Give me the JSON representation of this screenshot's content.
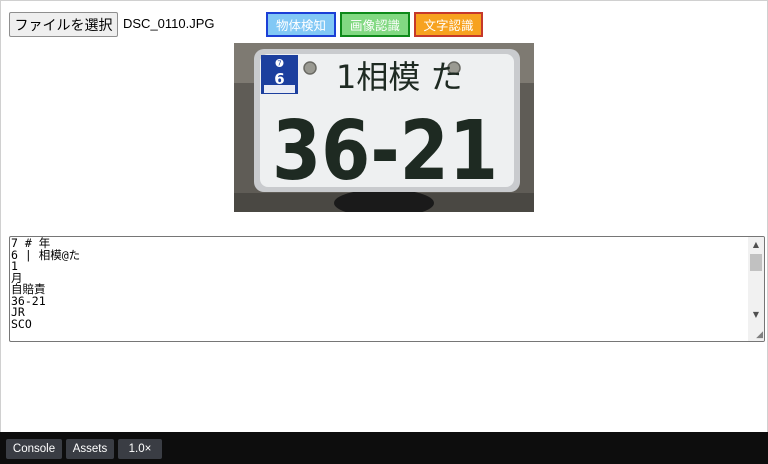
{
  "file_input": {
    "button_label": "ファイルを選択",
    "file_name": "DSC_0110.JPG"
  },
  "actions": {
    "object_detection": "物体検知",
    "image_recognition": "画像認識",
    "text_recognition": "文字認識"
  },
  "preview": {
    "plate_region_line": "1相模 た",
    "plate_number": "36-21",
    "sticker_month": "6",
    "sticker_year": "7"
  },
  "result": {
    "text": "7 # 年\n6 | 相模@た\n1\n月\n自賠責\n36-21\nJR\nSCO"
  },
  "devbar": {
    "console_label": "Console",
    "assets_label": "Assets",
    "zoom_label": "1.0×"
  },
  "colors": {
    "object_btn_bg": "#82c8f5",
    "image_btn_bg": "#82d982",
    "text_btn_bg": "#f7a21f",
    "devbar_bg": "#0d0d0d"
  }
}
